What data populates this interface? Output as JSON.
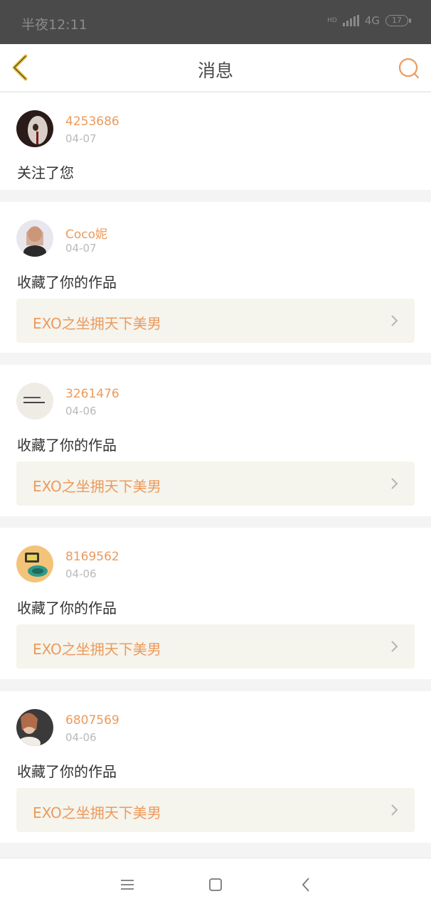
{
  "status_bar": {
    "time": "半夜12:11",
    "hd_label": "HD",
    "network": "4G",
    "battery": "17"
  },
  "header": {
    "back_icon": "back-chevron-icon",
    "title": "消息",
    "search_icon": "search-icon"
  },
  "colors": {
    "accent": "#ec9a5c",
    "back_icon": "#e8c13a",
    "status_bar": "#4a4a4a",
    "link_bg": "#f5f4ed"
  },
  "messages": [
    {
      "user": "4253686",
      "date": "04-07",
      "action": "关注了您"
    },
    {
      "user": "Coco妮",
      "date": "04-07",
      "action": "收藏了你的作品",
      "work": "EXO之坐拥天下美男"
    },
    {
      "user": "3261476",
      "date": "04-06",
      "action": "收藏了你的作品",
      "work": "EXO之坐拥天下美男"
    },
    {
      "user": "8169562",
      "date": "04-06",
      "action": "收藏了你的作品",
      "work": "EXO之坐拥天下美男"
    },
    {
      "user": "6807569",
      "date": "04-06",
      "action": "收藏了你的作品",
      "work": "EXO之坐拥天下美男"
    }
  ],
  "nav_bar": {
    "menu_icon": "menu-icon",
    "home_icon": "home-square-icon",
    "back_icon": "back-triangle-icon"
  }
}
